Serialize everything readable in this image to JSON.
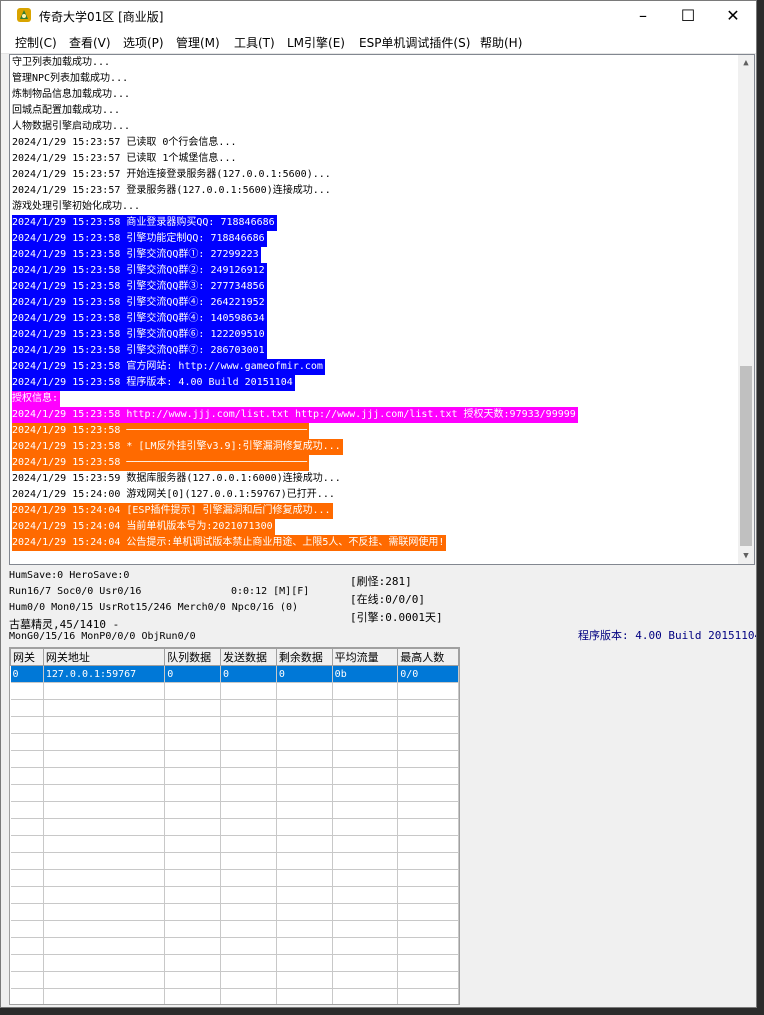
{
  "window": {
    "title": "传奇大学01区 [商业版]",
    "controls": {
      "minimize": "–",
      "maximize": "☐",
      "close": "✕"
    }
  },
  "menu": [
    "控制(C)",
    "查看(V)",
    "选项(P)",
    "管理(M)",
    "工具(T)",
    "LM引擎(E)",
    "ESP单机调试插件(S)",
    "帮助(H)"
  ],
  "log": [
    {
      "text": "守卫列表加载成功...",
      "style": ""
    },
    {
      "text": "管理NPC列表加载成功...",
      "style": ""
    },
    {
      "text": "炼制物品信息加载成功...",
      "style": ""
    },
    {
      "text": "回城点配置加载成功...",
      "style": ""
    },
    {
      "text": "人物数据引擎启动成功...",
      "style": ""
    },
    {
      "text": "2024/1/29 15:23:57 已读取 0个行会信息...",
      "style": ""
    },
    {
      "text": "2024/1/29 15:23:57 已读取 1个城堡信息...",
      "style": ""
    },
    {
      "text": "2024/1/29 15:23:57 开始连接登录服务器(127.0.0.1:5600)...",
      "style": ""
    },
    {
      "text": "2024/1/29 15:23:57 登录服务器(127.0.0.1:5600)连接成功...",
      "style": ""
    },
    {
      "text": "游戏处理引擎初始化成功...",
      "style": ""
    },
    {
      "text": "2024/1/29 15:23:58 商业登录器购买QQ: 718846686",
      "style": "blue"
    },
    {
      "text": "2024/1/29 15:23:58 引擎功能定制QQ: 718846686",
      "style": "blue"
    },
    {
      "text": "2024/1/29 15:23:58 引擎交流QQ群①: 27299223",
      "style": "blue"
    },
    {
      "text": "2024/1/29 15:23:58 引擎交流QQ群②: 249126912",
      "style": "blue"
    },
    {
      "text": "2024/1/29 15:23:58 引擎交流QQ群③: 277734856",
      "style": "blue"
    },
    {
      "text": "2024/1/29 15:23:58 引擎交流QQ群④: 264221952",
      "style": "blue"
    },
    {
      "text": "2024/1/29 15:23:58 引擎交流QQ群④: 140598634",
      "style": "blue"
    },
    {
      "text": "2024/1/29 15:23:58 引擎交流QQ群⑥: 122209510",
      "style": "blue"
    },
    {
      "text": "2024/1/29 15:23:58 引擎交流QQ群⑦: 286703001",
      "style": "blue"
    },
    {
      "text": "2024/1/29 15:23:58 官方网站: http://www.gameofmir.com",
      "style": "blue"
    },
    {
      "text": "2024/1/29 15:23:58 程序版本: 4.00 Build 20151104",
      "style": "blue"
    },
    {
      "text": "授权信息:",
      "style": "mag"
    },
    {
      "text": "2024/1/29 15:23:58 http://www.jjj.com/list.txt http://www.jjj.com/list.txt 授权天数:97933/99999",
      "style": "mag"
    },
    {
      "text": "2024/1/29 15:23:58 ──────────────────────────────",
      "style": "org"
    },
    {
      "text": "2024/1/29 15:23:58 * [LM反外挂引擎v3.9]:引擎漏洞修复成功...",
      "style": "org"
    },
    {
      "text": "2024/1/29 15:23:58 ──────────────────────────────",
      "style": "org"
    },
    {
      "text": "2024/1/29 15:23:59 数据库服务器(127.0.0.1:6000)连接成功...",
      "style": ""
    },
    {
      "text": "2024/1/29 15:24:00 游戏网关[0](127.0.0.1:59767)已打开...",
      "style": ""
    },
    {
      "text": "2024/1/29 15:24:04 [ESP插件提示] 引擎漏洞和后门修复成功...",
      "style": "org"
    },
    {
      "text": "2024/1/29 15:24:04 当前单机版本号为:2021071300",
      "style": "org"
    },
    {
      "text": "2024/1/29 15:24:04 公告提示:单机调试版本禁止商业用途、上限5人、不反挂、需联网使用!",
      "style": "org"
    }
  ],
  "status": {
    "line1": "HumSave:0 HeroSave:0",
    "line2": "Run16/7 Soc0/0 Usr0/16",
    "timer": "0:0:12 [M][F]",
    "line3": "Hum0/0 Mon0/15 UsrRot15/246 Merch0/0 Npc0/16 (0)",
    "line4": "古墓精灵,45/1410 -",
    "line5": "MonG0/15/16 MonP0/0/0 ObjRun0/0",
    "refresh": "[刷怪:281]",
    "online": "[在线:0/0/0]",
    "engine": "[引擎:0.0001天]",
    "version": "程序版本: 4.00 Build 20151104"
  },
  "grid": {
    "headers": [
      "网关",
      "网关地址",
      "队列数据",
      "发送数据",
      "剩余数据",
      "平均流量",
      "最高人数"
    ],
    "rows": [
      [
        "0",
        "127.0.0.1:59767",
        "0",
        "0",
        "0",
        "0b",
        "0/0"
      ]
    ]
  }
}
